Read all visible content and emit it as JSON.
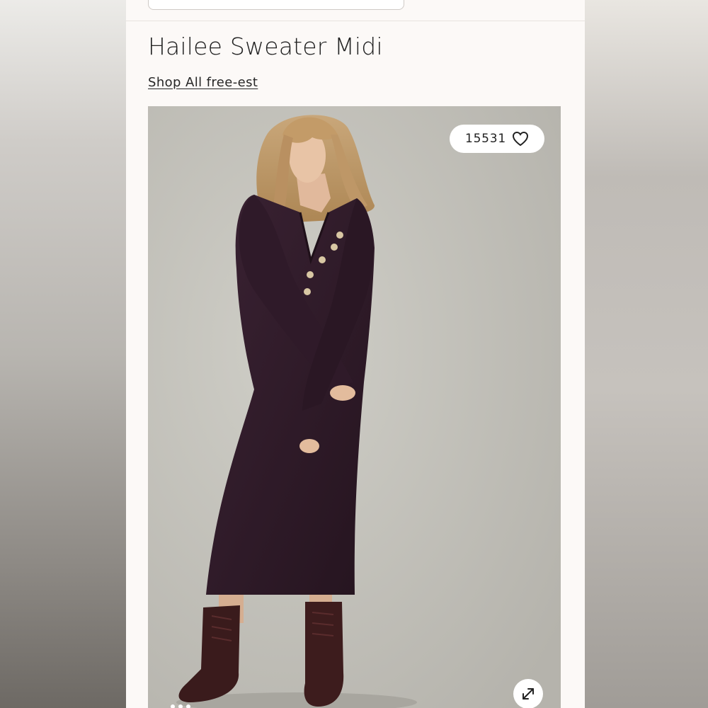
{
  "product": {
    "title": "Hailee Sweater Midi",
    "shop_all_link": "Shop All free-est"
  },
  "gallery": {
    "like_count": "15531",
    "like_icon": "heart-outline-icon",
    "expand_icon": "expand-arrows-icon",
    "active_slide_index": 0,
    "visible_slide_dots": 3
  },
  "colors": {
    "panel_background": "#fcf9f7",
    "photo_background": "#c4c3bc",
    "dress": "#2e1a28",
    "text": "#222222"
  }
}
